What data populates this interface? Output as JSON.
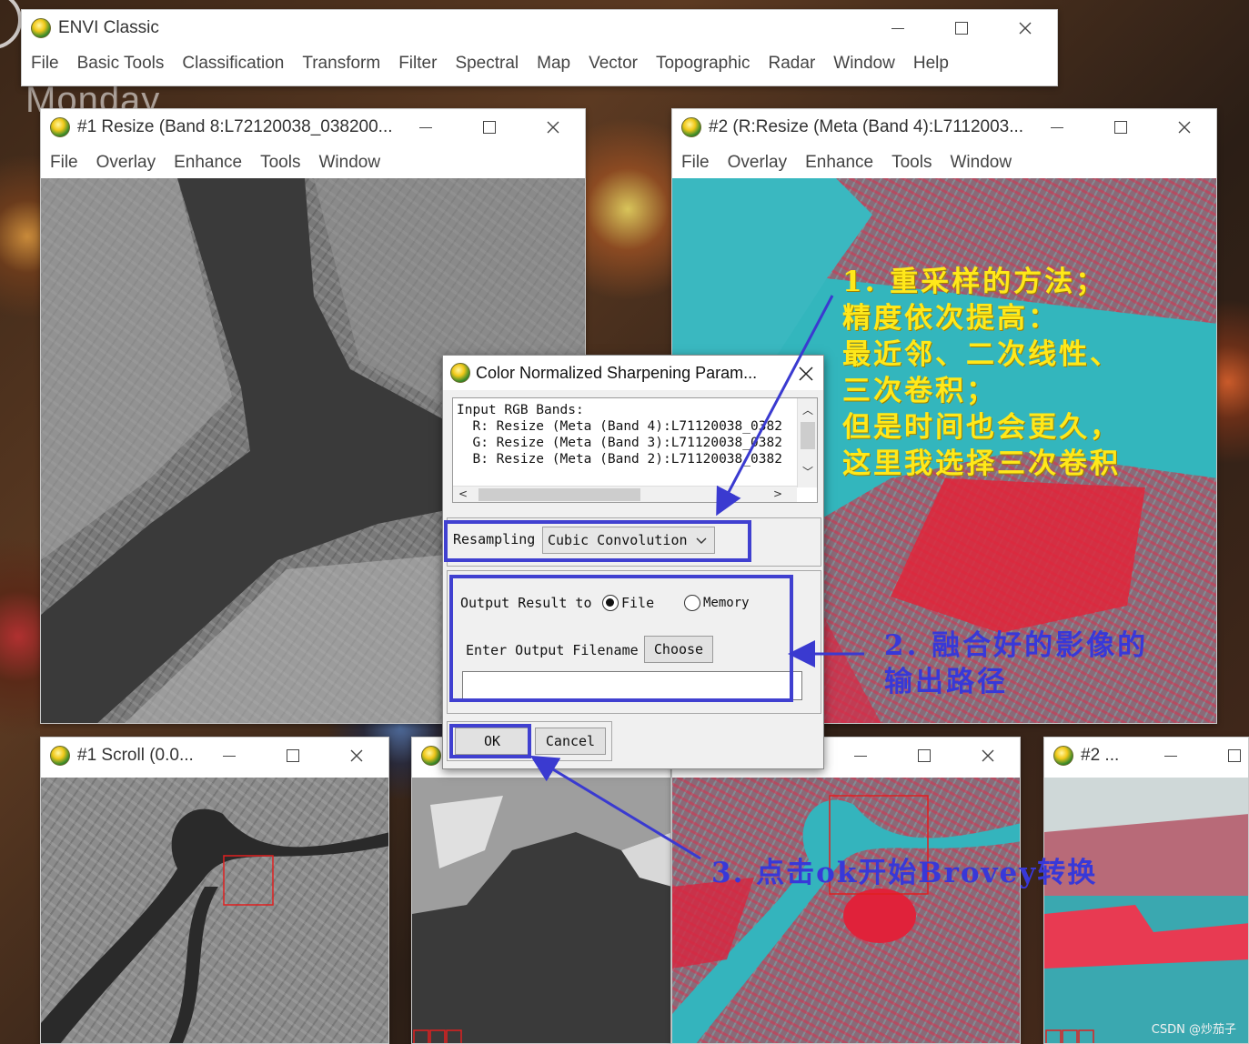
{
  "desktop": {
    "clock_text": "Monday"
  },
  "envi_main": {
    "title": "ENVI Classic",
    "menu": [
      "File",
      "Basic Tools",
      "Classification",
      "Transform",
      "Filter",
      "Spectral",
      "Map",
      "Vector",
      "Topographic",
      "Radar",
      "Window",
      "Help"
    ]
  },
  "display1": {
    "title": "#1 Resize (Band 8:L72120038_038200...",
    "menu": [
      "File",
      "Overlay",
      "Enhance",
      "Tools",
      "Window"
    ]
  },
  "display2": {
    "title": "#2 (R:Resize (Meta (Band 4):L7112003...",
    "menu": [
      "File",
      "Overlay",
      "Enhance",
      "Tools",
      "Window"
    ]
  },
  "scroll1": {
    "title": "#1 Scroll (0.0..."
  },
  "scroll2": {
    "title": "#2 ..."
  },
  "dialog": {
    "title": "Color Normalized Sharpening Param...",
    "input_lines": [
      "Input RGB Bands:",
      "  R: Resize (Meta (Band 4):L71120038_0382",
      "  G: Resize (Meta (Band 3):L71120038_0382",
      "  B: Resize (Meta (Band 2):L71120038_0382"
    ],
    "resampling_label": "Resampling",
    "resampling_value": "Cubic Convolution",
    "output_label": "Output Result to",
    "output_file": "File",
    "output_memory": "Memory",
    "output_selected": "File",
    "filename_label": "Enter Output Filename",
    "choose_label": "Choose",
    "filename_value": "",
    "ok_label": "OK",
    "cancel_label": "Cancel"
  },
  "annotations": {
    "note1": "1. 重采样的方法；\n精度依次提高：\n最近邻、二次线性、\n三次卷积；\n但是时间也会更久，\n这里我选择三次卷积",
    "note2": "2. 融合好的影像的\n输出路径",
    "note3": "3. 点击ok开始Brovey转换",
    "colors": {
      "yellow": "#ffe81a",
      "blue": "#3838d8"
    }
  },
  "watermark": "CSDN @炒茄子"
}
